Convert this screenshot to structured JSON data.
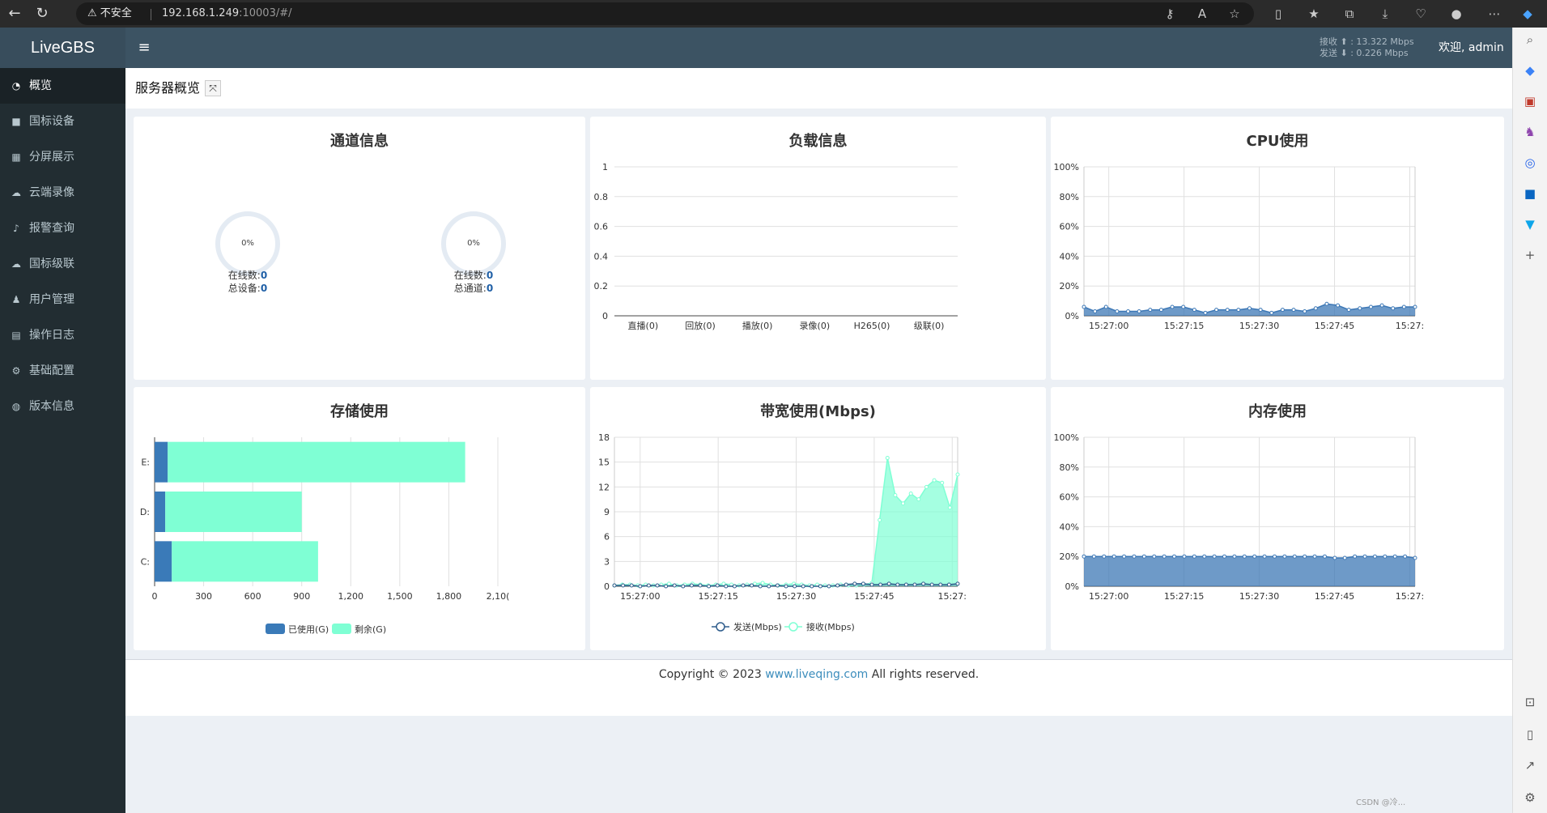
{
  "browser": {
    "security_label": "不安全",
    "url_host": "192.168.1.249",
    "url_rest": ":10003/#/"
  },
  "app": {
    "logo": "LiveGBS",
    "netstat": {
      "recv_label": "接收",
      "recv_value": "13.322 Mbps",
      "send_label": "发送",
      "send_value": "0.226 Mbps"
    },
    "welcome": "欢迎, admin"
  },
  "sidebar": {
    "items": [
      {
        "label": "概览",
        "icon": "dashboard-icon"
      },
      {
        "label": "国标设备",
        "icon": "video-camera-icon"
      },
      {
        "label": "分屏展示",
        "icon": "grid-icon"
      },
      {
        "label": "云端录像",
        "icon": "cloud-icon"
      },
      {
        "label": "报警查询",
        "icon": "bell-icon"
      },
      {
        "label": "国标级联",
        "icon": "cloud-upload-icon"
      },
      {
        "label": "用户管理",
        "icon": "users-icon"
      },
      {
        "label": "操作日志",
        "icon": "file-icon"
      },
      {
        "label": "基础配置",
        "icon": "gears-icon"
      },
      {
        "label": "版本信息",
        "icon": "globe-icon"
      }
    ]
  },
  "page": {
    "title": "服务器概览"
  },
  "panels": {
    "channel": {
      "title": "通道信息",
      "devices": {
        "percent": "0%",
        "online_label": "在线数:",
        "online": "0",
        "total_label": "总设备:",
        "total": "0"
      },
      "channels": {
        "percent": "0%",
        "online_label": "在线数:",
        "online": "0",
        "total_label": "总通道:",
        "total": "0"
      }
    },
    "load": {
      "title": "负载信息"
    },
    "cpu": {
      "title": "CPU使用"
    },
    "storage": {
      "title": "存储使用"
    },
    "bandwidth": {
      "title": "带宽使用(Mbps)"
    },
    "memory": {
      "title": "内存使用"
    }
  },
  "chart_data": [
    {
      "id": "load",
      "type": "bar",
      "categories": [
        "直播(0)",
        "回放(0)",
        "播放(0)",
        "录像(0)",
        "H265(0)",
        "级联(0)"
      ],
      "values": [
        0,
        0,
        0,
        0,
        0,
        0
      ],
      "ylim": [
        0,
        1
      ],
      "yticks": [
        "0",
        "0.2",
        "0.4",
        "0.6",
        "0.8",
        "1"
      ],
      "grid": true
    },
    {
      "id": "cpu",
      "type": "area",
      "title": "CPU使用",
      "xticks": [
        "15:27:00",
        "15:27:15",
        "15:27:30",
        "15:27:45",
        "15:27:"
      ],
      "yticks": [
        "0%",
        "20%",
        "40%",
        "60%",
        "80%",
        "100%"
      ],
      "ylim": [
        0,
        100
      ],
      "values": [
        6,
        3,
        6,
        3,
        3,
        3,
        4,
        4,
        6,
        6,
        4,
        2,
        4,
        4,
        4,
        5,
        4,
        2,
        4,
        4,
        3,
        5,
        8,
        7,
        4,
        5,
        6,
        7,
        5,
        6,
        6
      ],
      "color": "#3d78b6",
      "grid": true
    },
    {
      "id": "storage",
      "type": "bar",
      "orientation": "horizontal",
      "stacked": true,
      "categories": [
        "E:",
        "D:",
        "C:"
      ],
      "series": [
        {
          "name": "已使用(G)",
          "values": [
            80,
            65,
            105
          ],
          "color": "#3a7ab8"
        },
        {
          "name": "剩余(G)",
          "values": [
            1820,
            835,
            895
          ],
          "color": "#7fffd4"
        }
      ],
      "xlim": [
        0,
        2100
      ],
      "xticks": [
        "0",
        "300",
        "600",
        "900",
        "1,200",
        "1,500",
        "1,800",
        "2,10("
      ],
      "legend": "bottom",
      "grid": true
    },
    {
      "id": "bandwidth",
      "type": "area",
      "title": "带宽使用(Mbps)",
      "xticks": [
        "15:27:00",
        "15:27:15",
        "15:27:30",
        "15:27:45",
        "15:27:"
      ],
      "yticks": [
        "0",
        "3",
        "6",
        "9",
        "12",
        "15",
        "18"
      ],
      "ylim": [
        0,
        18
      ],
      "series": [
        {
          "name": "发送(Mbps)",
          "color": "#2f5d8c",
          "values": [
            0.1,
            0.1,
            0.1,
            0,
            0.1,
            0.1,
            0,
            0.1,
            0,
            0.1,
            0.1,
            0,
            0.1,
            0,
            0,
            0.1,
            0.1,
            0,
            0,
            0.1,
            0,
            0,
            0,
            0,
            0,
            0,
            0.1,
            0.2,
            0.3,
            0.3,
            0.2,
            0.2,
            0.3,
            0.2,
            0.2,
            0.2,
            0.3,
            0.2,
            0.2,
            0.2,
            0.3
          ]
        },
        {
          "name": "接收(Mbps)",
          "color": "#7fffd4",
          "values": [
            0.1,
            0.2,
            0.2,
            0.1,
            0.2,
            0.1,
            0.2,
            0.3,
            0.1,
            0.2,
            0.3,
            0.2,
            0.1,
            0.2,
            0.3,
            0.2,
            0.1,
            0.2,
            0.3,
            0.4,
            0.2,
            0.1,
            0.2,
            0.3,
            0.2,
            0.1,
            0.2,
            0.1,
            0.1,
            0.2,
            0.1,
            0.1,
            0.2,
            0.4,
            8,
            15.5,
            11,
            10,
            11.2,
            10.5,
            12,
            12.8,
            12.5,
            9.5,
            13.5
          ]
        }
      ],
      "legend": "bottom",
      "grid": true
    },
    {
      "id": "memory",
      "type": "area",
      "title": "内存使用",
      "xticks": [
        "15:27:00",
        "15:27:15",
        "15:27:30",
        "15:27:45",
        "15:27:"
      ],
      "yticks": [
        "0%",
        "20%",
        "40%",
        "60%",
        "80%",
        "100%"
      ],
      "ylim": [
        0,
        100
      ],
      "values": [
        20,
        20,
        20,
        20,
        20,
        20,
        20,
        20,
        20,
        20,
        20,
        20,
        20,
        20,
        20,
        20,
        20,
        20,
        20,
        20,
        20,
        20,
        20,
        20,
        20,
        19,
        19,
        20,
        20,
        20,
        20,
        20,
        20,
        19
      ],
      "color": "#3d78b6",
      "grid": true
    }
  ],
  "footer": {
    "prefix": "Copyright © 2023 ",
    "link": "www.liveqing.com",
    "suffix": " All rights reserved."
  },
  "watermark": "CSDN @冷..."
}
